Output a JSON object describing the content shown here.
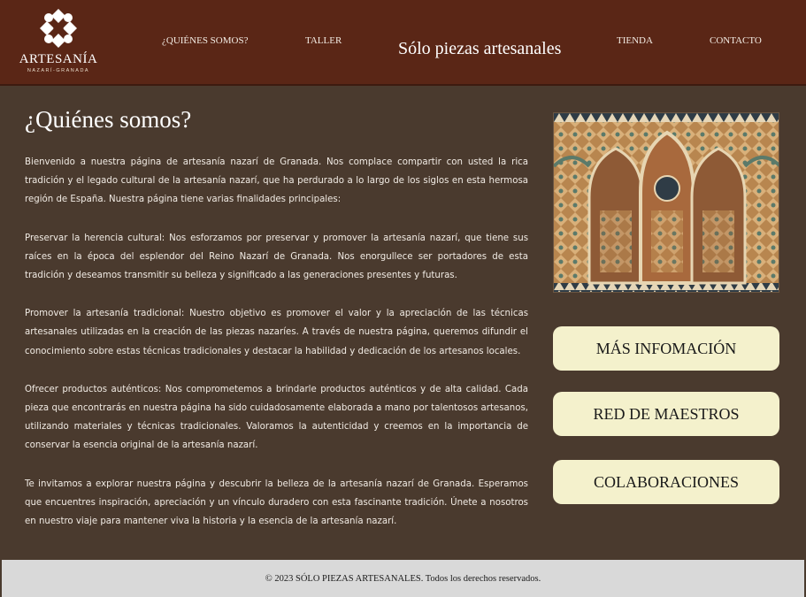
{
  "header": {
    "logo": {
      "title": "ARTESANÍA",
      "subtitle": "NAZARÍ-GRANADA",
      "icon": "geometric-star-icon"
    },
    "nav": [
      "¿QUIÉNES SOMOS?",
      "TALLER",
      "TIENDA",
      "CONTACTO"
    ],
    "tagline": "Sólo piezas artesanales"
  },
  "main": {
    "title": "¿Quiénes somos?",
    "paragraphs": [
      "Bienvenido a nuestra página de artesanía nazarí de Granada. Nos complace compartir con usted la rica tradición y el legado cultural de la artesanía nazarí, que ha perdurado a lo largo de los siglos en esta hermosa región de España. Nuestra página tiene varias finalidades principales:",
      "Preservar la herencia cultural: Nos esforzamos por preservar y promover la artesanía nazarí, que tiene sus raíces en la época del esplendor del Reino Nazarí de Granada. Nos enorgullece ser portadores de esta tradición y deseamos transmitir su belleza y significado a las generaciones presentes y futuras.",
      "Promover la artesanía tradicional: Nuestro objetivo es promover el valor y la apreciación de las técnicas artesanales utilizadas en la creación de las piezas nazaríes. A través de nuestra página, queremos difundir el conocimiento sobre estas técnicas tradicionales y destacar la habilidad y dedicación de los artesanos locales.",
      "Ofrecer productos auténticos: Nos comprometemos a brindarle productos auténticos y de alta calidad. Cada pieza que encontrarás en nuestra página ha sido cuidadosamente elaborada a mano por talentosos artesanos, utilizando materiales y técnicas tradicionales. Valoramos la autenticidad y creemos en la importancia de conservar la esencia original de la artesanía nazarí.",
      "Te invitamos a explorar nuestra página y descubrir la belleza de la artesanía nazarí de Granada. Esperamos que encuentres inspiración, apreciación y un vínculo duradero con esta fascinante tradición. Únete a nosotros en nuestro viaje para mantener viva la historia y la esencia de la artesanía nazarí."
    ]
  },
  "sidebar": {
    "buttons": [
      "MÁS INFOMACIÓN",
      "RED DE MAESTROS",
      "COLABORACIONES"
    ]
  },
  "footer": {
    "text": "© 2023 SÓLO PIEZAS ARTESANALES. Todos los derechos reservados."
  },
  "colors": {
    "header_bg": "#5a2616",
    "page_bg": "#4a3a2e",
    "button_bg": "#f4f1cc",
    "footer_bg": "#d9d9d9"
  }
}
